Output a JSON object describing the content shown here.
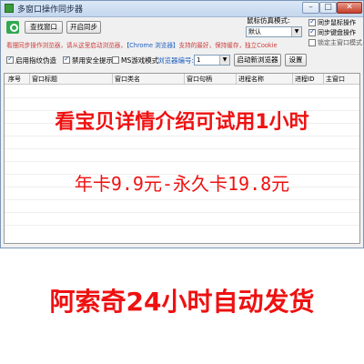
{
  "window": {
    "title": "多窗口操作同步器",
    "controls": {
      "minimize": "–",
      "maximize": "□",
      "close": "✕"
    }
  },
  "toolbar": {
    "find_window_label": "查找窗口",
    "start_sync_label": "开启同步",
    "mouse_mode_label": "鼠标仿真模式:",
    "mouse_mode_value": "默认",
    "sync_mouse_label": "同步鼠标操作",
    "sync_keyboard_label": "同步键盘操作",
    "lock_main_window_label": "锁定主窗口模式"
  },
  "info": {
    "part1": "看摆同步操作浏览器，请从这里启动浏览器，",
    "part2": "【Chrome 浏览器】",
    "part3": "支持的最好，保持缓存，独立Cookie"
  },
  "options": {
    "fingerprint_label": "启用指纹伪造",
    "disable_security_label": "禁用安全提示",
    "ms_game_label": "MS游戏模式",
    "browser_number_label": "浏览器编号:",
    "browser_number_value": "1",
    "launch_browser_label": "启动新浏览器",
    "settings_label": "设置"
  },
  "table": {
    "columns": [
      "序号",
      "窗口标题",
      "窗口类名",
      "窗口句柄",
      "进程名称",
      "进程ID",
      "主窗口"
    ]
  },
  "promo": {
    "line1": "看宝贝详情介绍可试用1小时",
    "line2": "年卡9.9元-永久卡19.8元",
    "line3": "阿索奇24小时自动发货"
  },
  "colors": {
    "promo_red": "#ee1111",
    "info_red": "#cc3b3b",
    "info_blue": "#1e5fc0"
  }
}
